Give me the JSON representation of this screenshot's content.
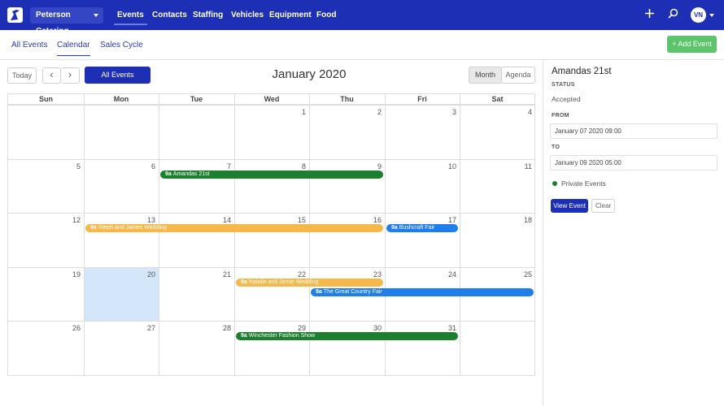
{
  "company": "Peterson Catering",
  "nav": [
    "Events",
    "Contacts",
    "Staffing",
    "Vehicles",
    "Equipment",
    "Food"
  ],
  "user_initials": "VN",
  "subtabs": [
    "All Events",
    "Calendar",
    "Sales Cycle"
  ],
  "add_event_label": "+ Add Event",
  "toolbar": {
    "today": "Today",
    "prev": "‹",
    "next": "›",
    "filter": "All Events",
    "title": "January 2020",
    "view_month": "Month",
    "view_agenda": "Agenda"
  },
  "weekdays": [
    "Sun",
    "Mon",
    "Tue",
    "Wed",
    "Thu",
    "Fri",
    "Sat"
  ],
  "weeks": [
    [
      "",
      "",
      "",
      "1",
      "2",
      "3",
      "4"
    ],
    [
      "5",
      "6",
      "7",
      "8",
      "9",
      "10",
      "11"
    ],
    [
      "12",
      "13",
      "14",
      "15",
      "16",
      "17",
      "18"
    ],
    [
      "19",
      "20",
      "21",
      "22",
      "23",
      "24",
      "25"
    ],
    [
      "26",
      "27",
      "28",
      "29",
      "30",
      "31",
      ""
    ]
  ],
  "highlighted_day": "20",
  "events": [
    {
      "time": "9a",
      "title": "Amandas 21st",
      "color": "#1b7f2e"
    },
    {
      "time": "9a",
      "title": "Steph and James Wedding",
      "color": "#f7b84b"
    },
    {
      "time": "9a",
      "title": "Bushcraft Fair",
      "color": "#1f7ee8"
    },
    {
      "time": "9a",
      "title": "Natalie and Jamie Wedding",
      "color": "#f7b84b"
    },
    {
      "time": "9a",
      "title": "The Great Country Fair",
      "color": "#1f7ee8"
    },
    {
      "time": "9a",
      "title": "Winchester Fashion Show",
      "color": "#1b7f2e"
    }
  ],
  "detail": {
    "title": "Amandas 21st",
    "status_label": "STATUS",
    "status": "Accepted",
    "from_label": "FROM",
    "from": "January 07 2020 09:00",
    "to_label": "TO",
    "to": "January 09 2020 05:00",
    "category": "Private Events",
    "view_button": "View Event",
    "clear_button": "Clear"
  },
  "colors": {
    "brand": "#1d2fb5",
    "add_button": "#5cc46a",
    "today_highlight": "#d3e6fa"
  }
}
